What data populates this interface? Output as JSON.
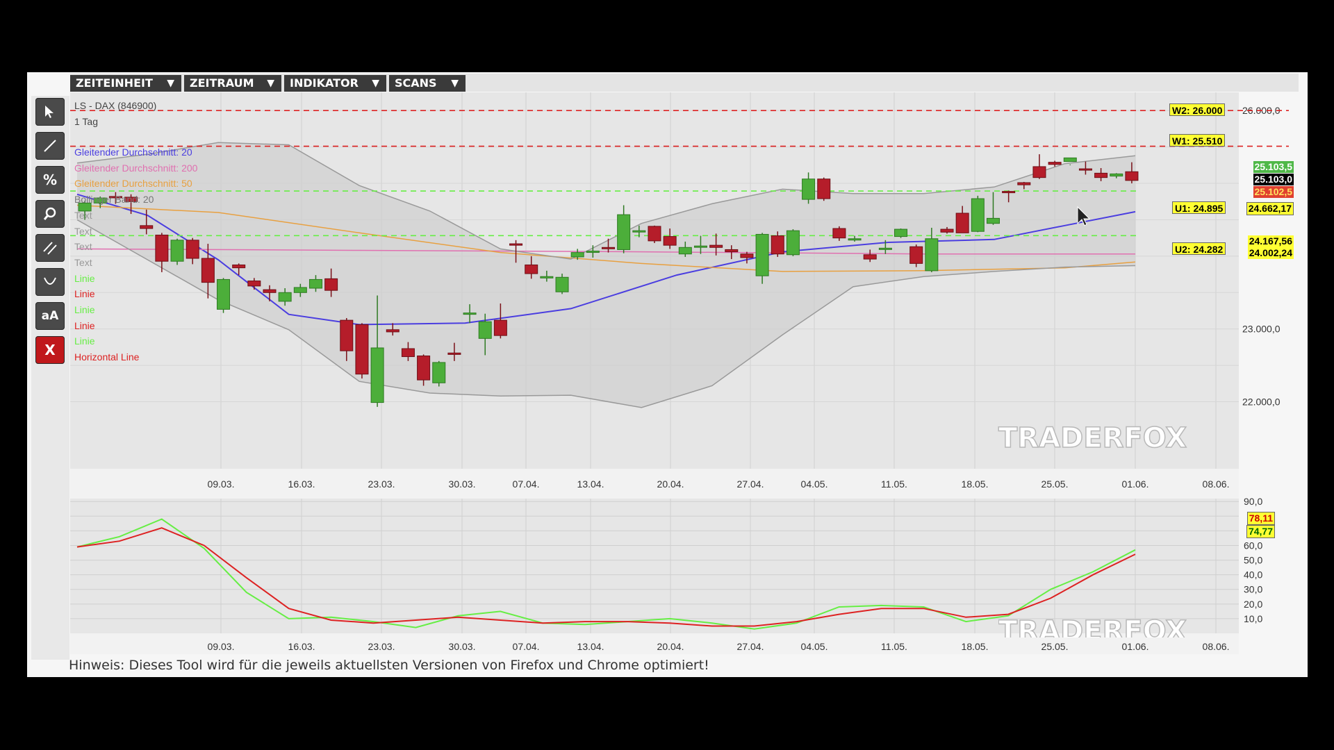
{
  "toolbar": {
    "menus": [
      {
        "label": "ZEITEINHEIT"
      },
      {
        "label": "ZEITRAUM"
      },
      {
        "label": "INDIKATOR"
      },
      {
        "label": "SCANS"
      }
    ],
    "arrow": "▼"
  },
  "tools": [
    "pointer-icon",
    "line-draw-icon",
    "percent-icon",
    "zoom-icon",
    "parallel-lines-icon",
    "arc-icon",
    "text-tool-icon",
    "delete-icon"
  ],
  "tool_labels": {
    "percent": "%",
    "text": "aA",
    "delete": "X"
  },
  "legend": {
    "title": "LS - DAX (846900)",
    "period": "1 Tag",
    "items": [
      {
        "label": "Gleitender Durchschnitt: 20",
        "color": "#4a3de0"
      },
      {
        "label": "Gleitender Durchschnitt: 200",
        "color": "#e070b0"
      },
      {
        "label": "Gleitender Durchschnitt: 50",
        "color": "#e8a040"
      },
      {
        "label": "Bollinger Band: 20",
        "color": "#777777"
      },
      {
        "label": "Text",
        "color": "#999999"
      },
      {
        "label": "Text",
        "color": "#999999"
      },
      {
        "label": "Text",
        "color": "#999999"
      },
      {
        "label": "Text",
        "color": "#999999"
      },
      {
        "label": "Linie",
        "color": "#66ee44"
      },
      {
        "label": "Linie",
        "color": "#dd2222"
      },
      {
        "label": "Linie",
        "color": "#66ee44"
      },
      {
        "label": "Linie",
        "color": "#dd2222"
      },
      {
        "label": "Linie",
        "color": "#66ee44"
      },
      {
        "label": "Horizontal Line",
        "color": "#dd2222"
      }
    ]
  },
  "levels": [
    {
      "label": "W2: 26.000",
      "value": 26000,
      "line": "#dd2222"
    },
    {
      "label": "W1: 25.510",
      "value": 25510,
      "line": "#dd2222"
    },
    {
      "label": "U1: 24.895",
      "value": 24895,
      "line": "#66ee44"
    },
    {
      "label": "U2: 24.282",
      "value": 24282,
      "line": "#66ee44"
    }
  ],
  "price_labels": [
    {
      "text": "25.103,5",
      "bg": "#4fb848",
      "fg": "#ffffff"
    },
    {
      "text": "25.103,0",
      "bg": "#000000",
      "fg": "#ffffff"
    },
    {
      "text": "25.102,5",
      "bg": "#e04030",
      "fg": "#ffe060"
    },
    {
      "text": "24.662,17",
      "bg": "#ffff33",
      "fg": "#000000"
    },
    {
      "text": "24.167,56",
      "bg": "#ffff33",
      "fg": "#000000"
    },
    {
      "text": "24.002,24",
      "bg": "#ffff33",
      "fg": "#000000"
    }
  ],
  "osc_labels": [
    {
      "text": "78,11",
      "bg": "#ffff33",
      "fg": "#cc0000"
    },
    {
      "text": "74,77",
      "bg": "#ffff33",
      "fg": "#006600"
    }
  ],
  "watermark": "TRADERFOX",
  "hint": "Hinweis: Dieses Tool wird für die jeweils aktuellsten Versionen von Firefox und Chrome optimiert!",
  "chart_data": [
    {
      "type": "candlestick",
      "title": "LS - DAX (846900)",
      "subtitle": "1 Tag",
      "x_ticks": [
        "09.03.",
        "16.03.",
        "23.03.",
        "30.03.",
        "07.04.",
        "13.04.",
        "20.04.",
        "27.04.",
        "04.05.",
        "11.05.",
        "18.05.",
        "25.05.",
        "01.06.",
        "08.06."
      ],
      "y_ticks": [
        "26.000,0",
        "23.000,0",
        "22.000,0"
      ],
      "y_tick_values": [
        26000,
        23000,
        22000
      ],
      "ylim": [
        21080,
        26250
      ],
      "candles": [
        [
          24620,
          24730,
          24600,
          24760,
          24500
        ],
        [
          24730,
          24800,
          24690,
          24820,
          24660
        ],
        [
          24820,
          24810,
          24760,
          24880,
          24720
        ],
        [
          24810,
          24750,
          24620,
          24850,
          24580
        ],
        [
          24420,
          24380,
          24340,
          24640,
          24300
        ],
        [
          24290,
          23930,
          23900,
          24320,
          23780
        ],
        [
          23930,
          24220,
          23920,
          24240,
          23880
        ],
        [
          24220,
          23970,
          23960,
          24250,
          23890
        ],
        [
          23970,
          23640,
          23600,
          24170,
          23420
        ],
        [
          23270,
          23680,
          23240,
          23700,
          23220
        ],
        [
          23880,
          23840,
          23780,
          23900,
          23740
        ],
        [
          23660,
          23590,
          23560,
          23700,
          23540
        ],
        [
          23540,
          23500,
          23430,
          23600,
          23380
        ],
        [
          23380,
          23500,
          23370,
          23560,
          23320
        ],
        [
          23500,
          23570,
          23460,
          23620,
          23440
        ],
        [
          23560,
          23680,
          23540,
          23740,
          23510
        ],
        [
          23690,
          23530,
          23530,
          23830,
          23440
        ],
        [
          23120,
          22700,
          22680,
          23150,
          22560
        ],
        [
          23060,
          22380,
          22360,
          23080,
          22320
        ],
        [
          21990,
          22740,
          21980,
          23460,
          21930
        ],
        [
          22990,
          22960,
          22940,
          23080,
          22910
        ],
        [
          22730,
          22620,
          22600,
          22820,
          22560
        ],
        [
          22630,
          22300,
          22270,
          22650,
          22220
        ],
        [
          22260,
          22540,
          22250,
          22560,
          22210
        ],
        [
          22670,
          22650,
          22630,
          22810,
          22560
        ],
        [
          23220,
          23220,
          23180,
          23340,
          23080
        ],
        [
          22870,
          23100,
          22860,
          23210,
          22640
        ],
        [
          23120,
          22910,
          22900,
          23350,
          22870
        ],
        [
          24170,
          24150,
          24110,
          24220,
          23910
        ],
        [
          23880,
          23760,
          23720,
          24000,
          23690
        ],
        [
          23700,
          23720,
          23680,
          23800,
          23650
        ],
        [
          23510,
          23710,
          23500,
          23760,
          23480
        ],
        [
          23990,
          24050,
          23980,
          24100,
          23950
        ],
        [
          24060,
          24070,
          24020,
          24150,
          23980
        ],
        [
          24120,
          24110,
          24100,
          24240,
          24050
        ],
        [
          24090,
          24570,
          24060,
          24700,
          24040
        ],
        [
          24350,
          24350,
          24300,
          24420,
          24260
        ],
        [
          24410,
          24210,
          24190,
          24420,
          24180
        ],
        [
          24270,
          24150,
          24120,
          24380,
          24100
        ],
        [
          24030,
          24120,
          24000,
          24200,
          23990
        ],
        [
          24140,
          24140,
          24100,
          24280,
          24030
        ],
        [
          24150,
          24120,
          24080,
          24310,
          24010
        ],
        [
          24090,
          24060,
          24000,
          24150,
          23960
        ],
        [
          24030,
          23980,
          23950,
          24060,
          23900
        ],
        [
          23730,
          24300,
          23700,
          24320,
          23620
        ],
        [
          24280,
          24030,
          24020,
          24340,
          23990
        ],
        [
          24020,
          24350,
          24000,
          24370,
          24000
        ],
        [
          24780,
          25060,
          24740,
          25150,
          24720
        ],
        [
          25060,
          24790,
          24760,
          25080,
          24760
        ],
        [
          24380,
          24250,
          24240,
          24410,
          24210
        ],
        [
          24240,
          24240,
          24200,
          24280,
          24200
        ],
        [
          24020,
          23960,
          23940,
          24090,
          23920
        ],
        [
          24110,
          24110,
          24080,
          24220,
          24030
        ],
        [
          24270,
          24370,
          24250,
          24380,
          24250
        ],
        [
          24130,
          23900,
          23870,
          24160,
          23850
        ],
        [
          23800,
          24240,
          23780,
          24390,
          23780
        ],
        [
          24370,
          24330,
          24300,
          24400,
          24310
        ],
        [
          24590,
          24320,
          24300,
          24690,
          24320
        ],
        [
          24340,
          24790,
          24330,
          24830,
          24330
        ],
        [
          24450,
          24520,
          24420,
          24880,
          24430
        ],
        [
          24890,
          24880,
          24860,
          24900,
          24740
        ],
        [
          25010,
          24980,
          24960,
          25020,
          24920
        ],
        [
          25230,
          25080,
          25060,
          25400,
          25060
        ],
        [
          25290,
          25260,
          25200,
          25310,
          25230
        ],
        [
          25300,
          25350,
          25310,
          25260,
          25250
        ],
        [
          25200,
          25190,
          25150,
          25300,
          25120
        ],
        [
          25140,
          25080,
          25050,
          25210,
          25030
        ],
        [
          25100,
          25130,
          25060,
          25140,
          25070
        ],
        [
          25160,
          25040,
          25010,
          25290,
          25000
        ]
      ],
      "series": [
        {
          "name": "Gleitender Durchschnitt: 20",
          "color": "#4a3de0",
          "values": [
            [
              0,
              24850
            ],
            [
              10,
              24560
            ],
            [
              20,
              23950
            ],
            [
              30,
              23200
            ],
            [
              40,
              23060
            ],
            [
              55,
              23080
            ],
            [
              70,
              23280
            ],
            [
              85,
              23740
            ],
            [
              100,
              24060
            ],
            [
              115,
              24190
            ],
            [
              130,
              24230
            ],
            [
              140,
              24420
            ],
            [
              150,
              24610
            ]
          ]
        },
        {
          "name": "Gleitender Durchschnitt: 200",
          "color": "#e070b0",
          "values": [
            [
              0,
              24100
            ],
            [
              40,
              24080
            ],
            [
              80,
              24060
            ],
            [
              120,
              24030
            ],
            [
              150,
              24030
            ]
          ]
        },
        {
          "name": "Gleitender Durchschnitt: 50",
          "color": "#e8a040",
          "values": [
            [
              0,
              24700
            ],
            [
              20,
              24600
            ],
            [
              40,
              24320
            ],
            [
              60,
              24050
            ],
            [
              80,
              23900
            ],
            [
              100,
              23790
            ],
            [
              120,
              23800
            ],
            [
              140,
              23840
            ],
            [
              150,
              23920
            ]
          ]
        },
        {
          "name": "Bollinger Band: 20 (oben)",
          "color": "#999999",
          "values": [
            [
              0,
              25280
            ],
            [
              10,
              25400
            ],
            [
              20,
              25560
            ],
            [
              30,
              25530
            ],
            [
              40,
              24970
            ],
            [
              50,
              24620
            ],
            [
              60,
              24100
            ],
            [
              70,
              23960
            ],
            [
              80,
              24450
            ],
            [
              90,
              24720
            ],
            [
              100,
              24920
            ],
            [
              110,
              24860
            ],
            [
              120,
              24860
            ],
            [
              130,
              24950
            ],
            [
              140,
              25270
            ],
            [
              150,
              25380
            ]
          ]
        },
        {
          "name": "Bollinger Band: 20 (unten)",
          "color": "#999999",
          "values": [
            [
              0,
              24500
            ],
            [
              10,
              23950
            ],
            [
              20,
              23400
            ],
            [
              30,
              22990
            ],
            [
              40,
              22280
            ],
            [
              50,
              22120
            ],
            [
              60,
              22080
            ],
            [
              70,
              22090
            ],
            [
              80,
              21920
            ],
            [
              90,
              22220
            ],
            [
              100,
              22920
            ],
            [
              110,
              23580
            ],
            [
              120,
              23720
            ],
            [
              130,
              23790
            ],
            [
              140,
              23850
            ],
            [
              150,
              23870
            ]
          ]
        }
      ],
      "levels": [
        26000,
        25510,
        24895,
        24282
      ]
    },
    {
      "type": "line",
      "x_ticks": [
        "09.03.",
        "16.03.",
        "23.03.",
        "30.03.",
        "07.04.",
        "13.04.",
        "20.04.",
        "27.04.",
        "04.05.",
        "11.05.",
        "18.05.",
        "25.05.",
        "01.06.",
        "08.06."
      ],
      "y_ticks": [
        "90,0",
        "60,0",
        "50,0",
        "40,0",
        "30,0",
        "20,0",
        "10,0"
      ],
      "y_tick_values": [
        90,
        60,
        50,
        40,
        30,
        20,
        10
      ],
      "ylim": [
        0,
        92
      ],
      "series": [
        {
          "name": "",
          "color": "#66ee44",
          "values": [
            [
              0,
              59
            ],
            [
              6,
              66
            ],
            [
              12,
              78
            ],
            [
              18,
              58
            ],
            [
              24,
              28
            ],
            [
              30,
              10
            ],
            [
              36,
              11
            ],
            [
              42,
              8
            ],
            [
              48,
              4
            ],
            [
              54,
              12
            ],
            [
              60,
              15
            ],
            [
              66,
              7
            ],
            [
              72,
              6
            ],
            [
              78,
              8
            ],
            [
              84,
              10
            ],
            [
              90,
              7
            ],
            [
              96,
              3
            ],
            [
              102,
              7
            ],
            [
              108,
              18
            ],
            [
              114,
              19
            ],
            [
              120,
              18
            ],
            [
              126,
              8
            ],
            [
              132,
              12
            ],
            [
              138,
              30
            ],
            [
              144,
              42
            ],
            [
              150,
              57
            ]
          ]
        },
        {
          "name": "",
          "color": "#dd2222",
          "values": [
            [
              0,
              59
            ],
            [
              6,
              63
            ],
            [
              12,
              72
            ],
            [
              18,
              60
            ],
            [
              24,
              38
            ],
            [
              30,
              17
            ],
            [
              36,
              9
            ],
            [
              42,
              7
            ],
            [
              48,
              9
            ],
            [
              54,
              11
            ],
            [
              60,
              9
            ],
            [
              66,
              7
            ],
            [
              72,
              8
            ],
            [
              78,
              8
            ],
            [
              84,
              7
            ],
            [
              90,
              5
            ],
            [
              96,
              5
            ],
            [
              102,
              8
            ],
            [
              108,
              13
            ],
            [
              114,
              17
            ],
            [
              120,
              17
            ],
            [
              126,
              11
            ],
            [
              132,
              13
            ],
            [
              138,
              24
            ],
            [
              144,
              40
            ],
            [
              150,
              54
            ]
          ]
        }
      ]
    }
  ]
}
